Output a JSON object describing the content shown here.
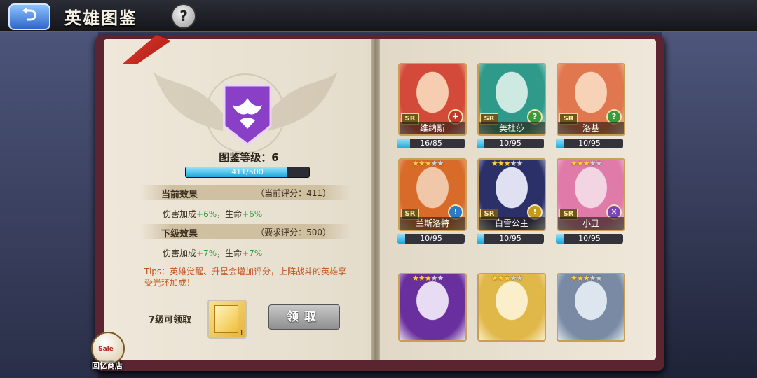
{
  "header": {
    "back_glyph": "⮌",
    "title": "英雄图鉴",
    "help_glyph": "?"
  },
  "codex": {
    "level_label": "图鉴等级：6",
    "progress_text": "411/500",
    "progress_fraction": 0.822
  },
  "current_effect": {
    "title": "当前效果",
    "score": "（当前评分：411）",
    "line_prefix": "伤害加成",
    "dmg": "+6%",
    "sep": "，生命",
    "hp": "+6%"
  },
  "next_effect": {
    "title": "下级效果",
    "score": "（要求评分：500）",
    "line_prefix": "伤害加成",
    "dmg": "+7%",
    "sep": "，生命",
    "hp": "+7%"
  },
  "tips": "Tips：英雄觉醒、升星会增加评分，上阵战斗的英雄享受光环加成！",
  "reward": {
    "label": "7级可领取",
    "qty": "1",
    "claim_label": "领取"
  },
  "shop": {
    "sale": "Sale",
    "label": "回忆商店"
  },
  "colors": {
    "progress": "#1ea6d8",
    "bonus": "#24a235",
    "tips": "#c1541e"
  },
  "heroes": [
    {
      "name": "维纳斯",
      "rarity": "SR",
      "stars_lit": 0,
      "progress": "16/85",
      "progress_fraction": 0.19,
      "class_icon": "plus-icon",
      "class_glyph": "✚",
      "class_color": "#c4352c",
      "palette": [
        "#f6cdb0",
        "#d44a3a"
      ]
    },
    {
      "name": "美杜莎",
      "rarity": "SR",
      "stars_lit": 0,
      "progress": "10/95",
      "progress_fraction": 0.11,
      "class_icon": "question-icon",
      "class_glyph": "?",
      "class_color": "#3c9a3a",
      "palette": [
        "#cde9e2",
        "#2f9a8a"
      ]
    },
    {
      "name": "洛基",
      "rarity": "SR",
      "stars_lit": 0,
      "progress": "10/95",
      "progress_fraction": 0.11,
      "class_icon": "question-icon",
      "class_glyph": "?",
      "class_color": "#3c9a3a",
      "palette": [
        "#f7d2b6",
        "#e0774e"
      ]
    },
    {
      "name": "兰斯洛特",
      "rarity": "SR",
      "stars_lit": 3,
      "progress": "10/95",
      "progress_fraction": 0.11,
      "class_icon": "shield-icon",
      "class_glyph": "!",
      "class_color": "#2c7bc4",
      "palette": [
        "#f0c7a8",
        "#d86a2a"
      ]
    },
    {
      "name": "白雪公主",
      "rarity": "SR",
      "stars_lit": 3,
      "progress": "10/95",
      "progress_fraction": 0.11,
      "class_icon": "shield-icon",
      "class_glyph": "!",
      "class_color": "#c79a1c",
      "palette": [
        "#dfe0f2",
        "#2c3068"
      ]
    },
    {
      "name": "小丑",
      "rarity": "SR",
      "stars_lit": 3,
      "progress": "10/95",
      "progress_fraction": 0.11,
      "class_icon": "sword-icon",
      "class_glyph": "✕",
      "class_color": "#7a45b8",
      "palette": [
        "#f2d4e2",
        "#e07aa8"
      ]
    },
    {
      "name": "",
      "rarity": "",
      "stars_lit": 3,
      "progress": "",
      "progress_fraction": 0,
      "class_icon": "",
      "class_glyph": "",
      "class_color": "#7a45b8",
      "palette": [
        "#e8dcf4",
        "#6a2f9e"
      ]
    },
    {
      "name": "",
      "rarity": "",
      "stars_lit": 3,
      "progress": "",
      "progress_fraction": 0,
      "class_icon": "",
      "class_glyph": "",
      "class_color": "#c79a1c",
      "palette": [
        "#fbeecb",
        "#e0b84a"
      ]
    },
    {
      "name": "",
      "rarity": "",
      "stars_lit": 3,
      "progress": "",
      "progress_fraction": 0,
      "class_icon": "",
      "class_glyph": "",
      "class_color": "#3c9a3a",
      "palette": [
        "#dde6ef",
        "#7a8aa4"
      ]
    }
  ]
}
